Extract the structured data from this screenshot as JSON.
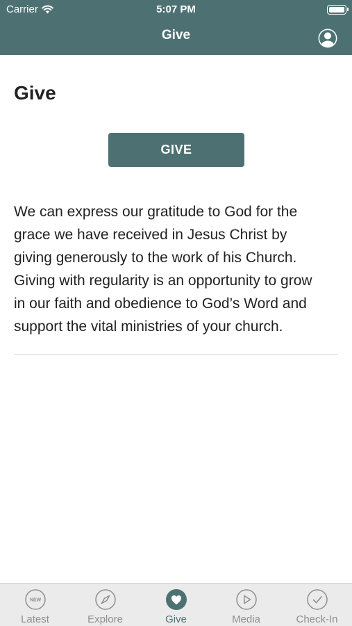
{
  "status_bar": {
    "carrier": "Carrier",
    "time": "5:07 PM"
  },
  "nav": {
    "title": "Give",
    "profile_icon": "person-circle-icon"
  },
  "main": {
    "heading": "Give",
    "give_button_label": "GIVE",
    "body_lines": [
      "We can express our gratitude to God for the",
      "grace we have received in Jesus Christ by",
      "giving generously to the work of his Church.",
      "Giving with regularity is an opportunity to grow",
      "in our faith and obedience to God’s Word and",
      "support the vital ministries of your church."
    ]
  },
  "tabs": [
    {
      "label": "Latest",
      "icon": "new-badge-icon",
      "badge_text": "NEW",
      "active": false
    },
    {
      "label": "Explore",
      "icon": "compass-icon",
      "active": false
    },
    {
      "label": "Give",
      "icon": "heart-icon",
      "active": true
    },
    {
      "label": "Media",
      "icon": "play-icon",
      "active": false
    },
    {
      "label": "Check-In",
      "icon": "check-icon",
      "active": false
    }
  ],
  "colors": {
    "brand": "#4d7172",
    "tab_inactive": "#8e8e8e",
    "tab_bar_bg": "#ebebeb"
  }
}
